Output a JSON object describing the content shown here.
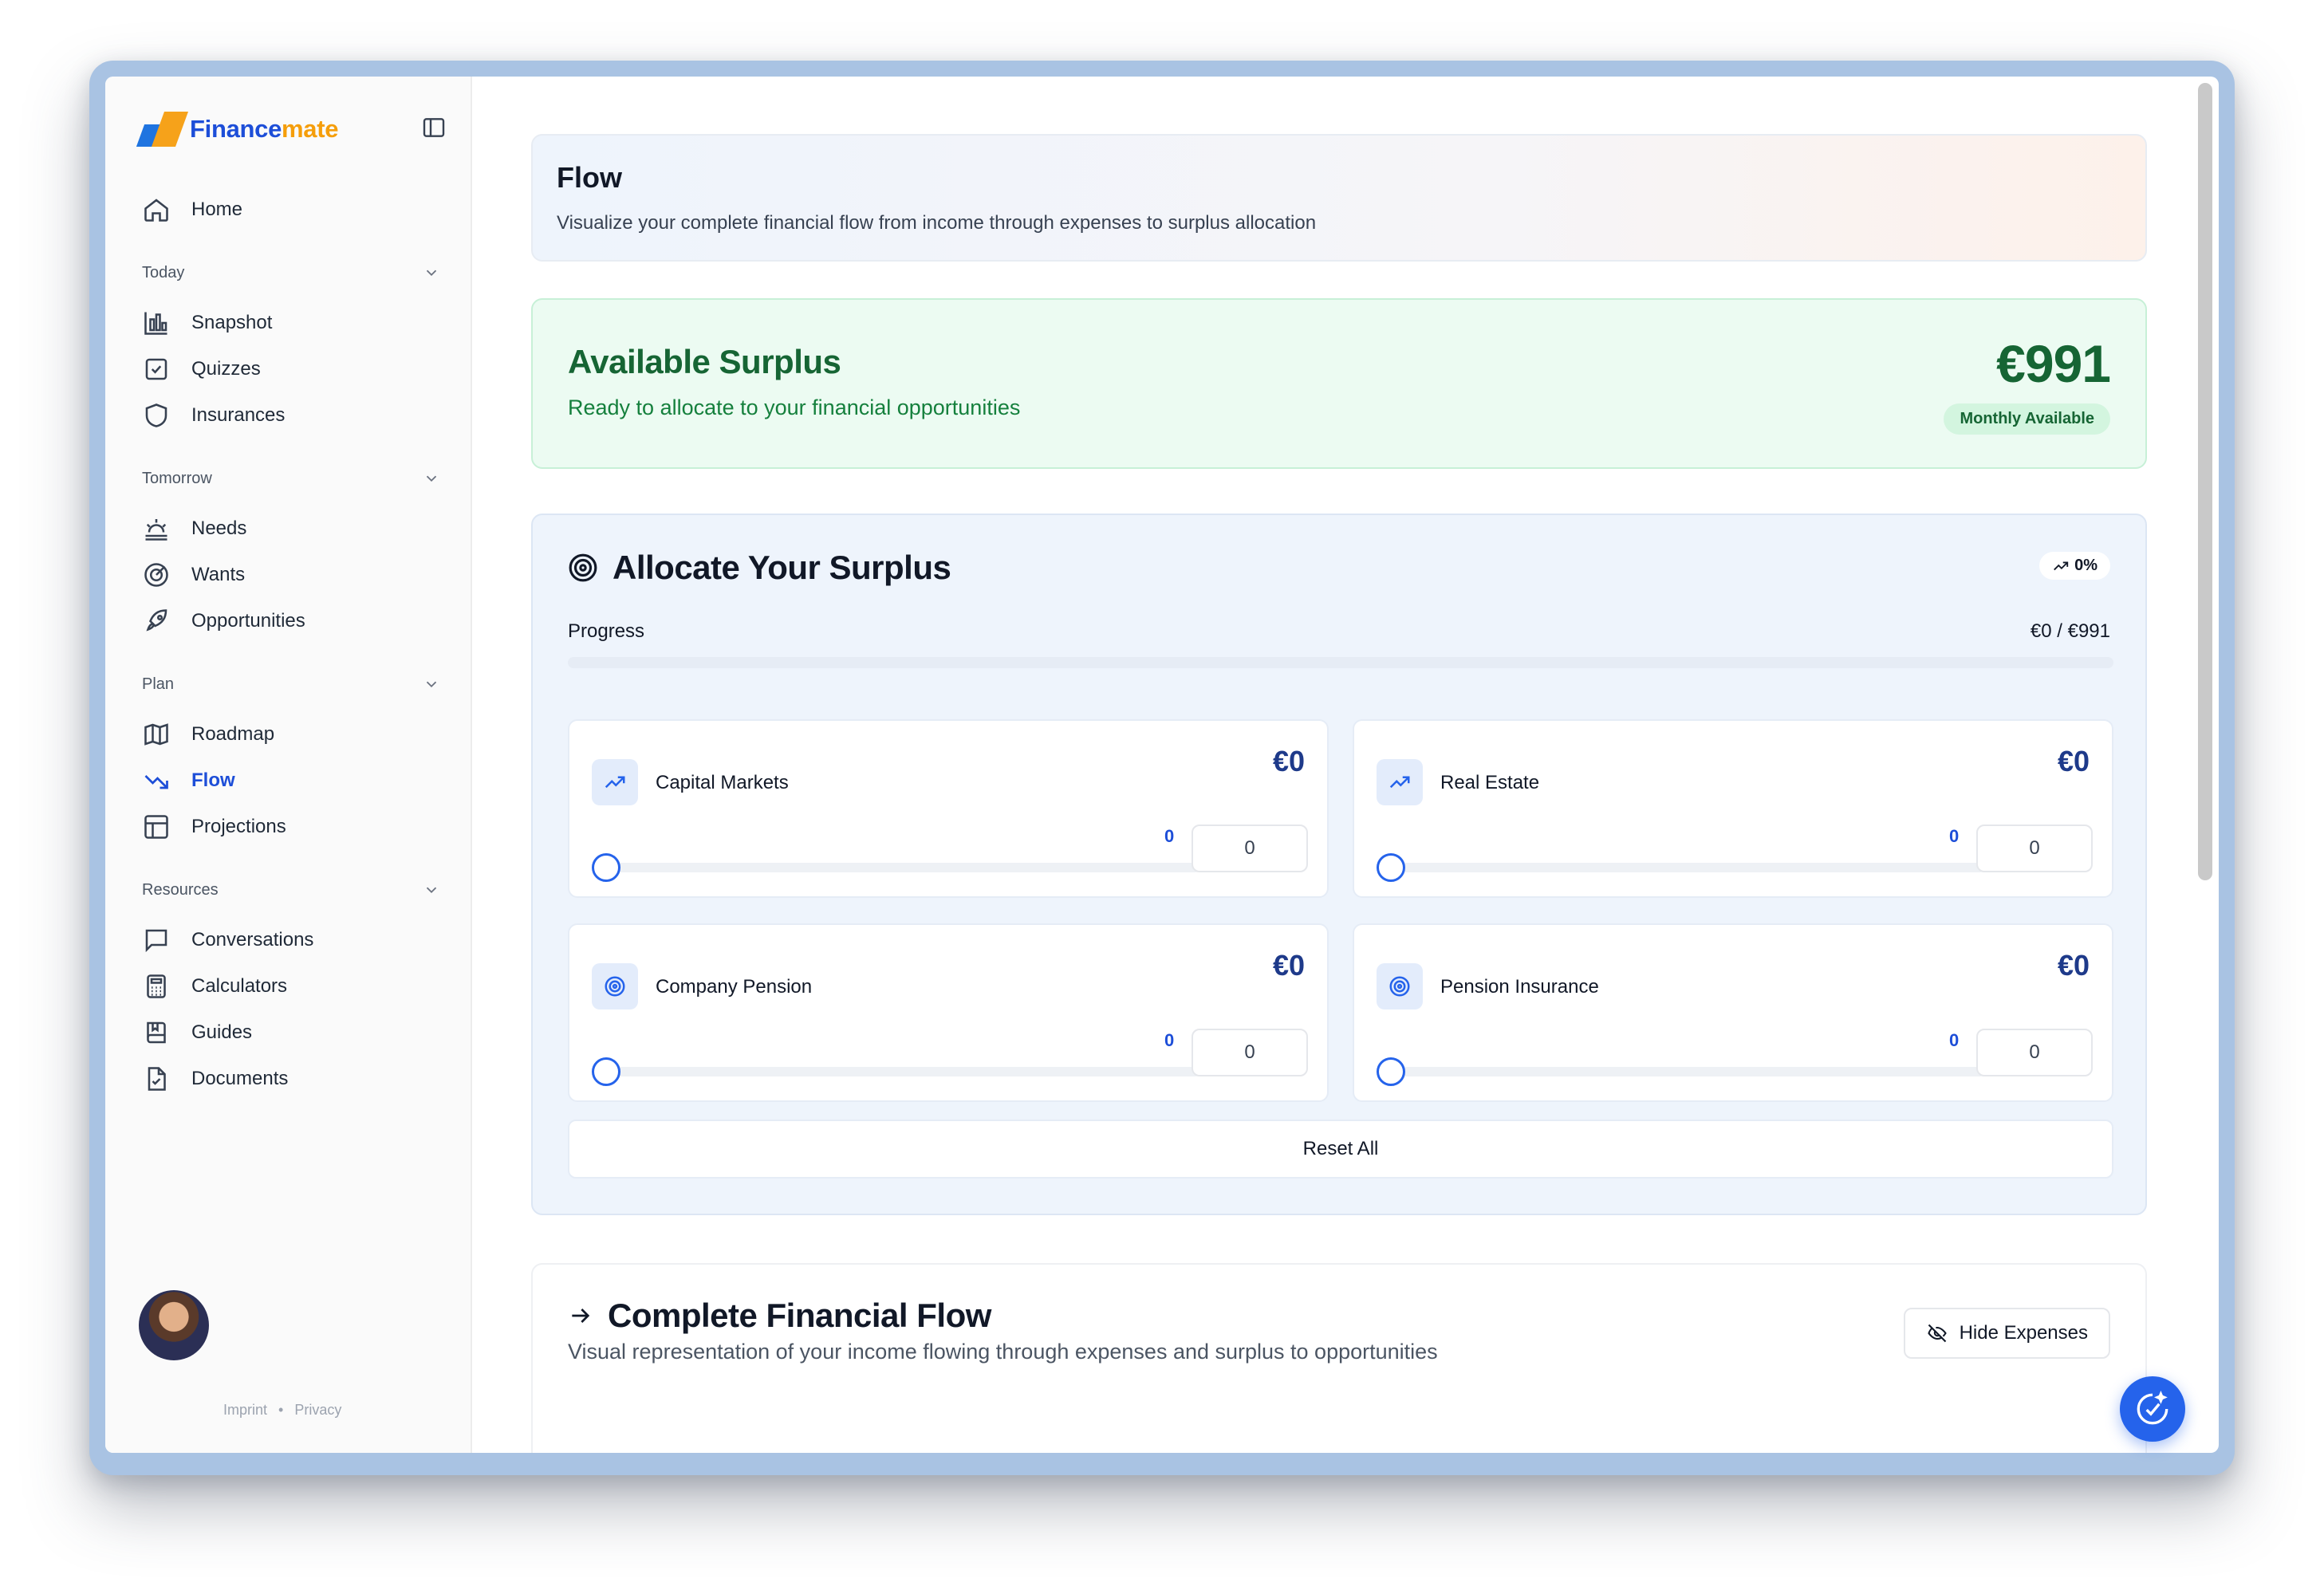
{
  "app": {
    "logo_part1": "Finance",
    "logo_part2": "mate"
  },
  "sidebar": {
    "home": "Home",
    "groups": [
      {
        "label": "Today",
        "items": [
          "Snapshot",
          "Quizzes",
          "Insurances"
        ]
      },
      {
        "label": "Tomorrow",
        "items": [
          "Needs",
          "Wants",
          "Opportunities"
        ]
      },
      {
        "label": "Plan",
        "items": [
          "Roadmap",
          "Flow",
          "Projections"
        ]
      },
      {
        "label": "Resources",
        "items": [
          "Conversations",
          "Calculators",
          "Guides",
          "Documents"
        ]
      }
    ],
    "active_item": "Flow",
    "footer": {
      "imprint": "Imprint",
      "separator": "•",
      "privacy": "Privacy"
    }
  },
  "header": {
    "title": "Flow",
    "subtitle": "Visualize your complete financial flow from income through expenses to surplus allocation"
  },
  "surplus": {
    "title": "Available Surplus",
    "subtitle": "Ready to allocate to your financial opportunities",
    "amount": "€991",
    "badge": "Monthly Available"
  },
  "allocate": {
    "title": "Allocate Your Surplus",
    "trend": "0%",
    "progress_label": "Progress",
    "progress_value": "€0 / €991",
    "progress_fraction": 0,
    "opportunities": [
      {
        "name": "Capital Markets",
        "amount": "€0",
        "slider_value": "0",
        "input_value": "0",
        "icon": "trending-up-icon"
      },
      {
        "name": "Real Estate",
        "amount": "€0",
        "slider_value": "0",
        "input_value": "0",
        "icon": "trending-up-icon"
      },
      {
        "name": "Company Pension",
        "amount": "€0",
        "slider_value": "0",
        "input_value": "0",
        "icon": "target-icon"
      },
      {
        "name": "Pension Insurance",
        "amount": "€0",
        "slider_value": "0",
        "input_value": "0",
        "icon": "target-icon"
      }
    ],
    "reset_label": "Reset All"
  },
  "flow": {
    "title": "Complete Financial Flow",
    "subtitle": "Visual representation of your income flowing through expenses and surplus to opportunities",
    "hide_button": "Hide Expenses"
  },
  "colors": {
    "accent": "#1d4ed8",
    "surplus_green": "#166534",
    "logo_blue": "#1f74e0",
    "logo_orange": "#f6a21a"
  }
}
